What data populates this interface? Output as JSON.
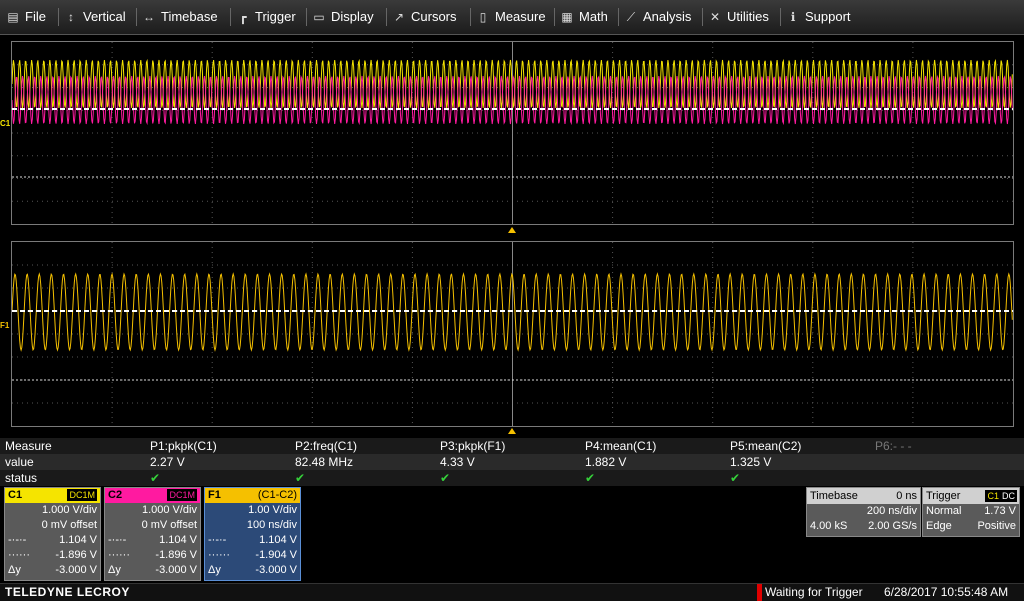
{
  "menu": [
    {
      "label": "File",
      "icon": "file-icon"
    },
    {
      "label": "Vertical",
      "icon": "vertical-icon"
    },
    {
      "label": "Timebase",
      "icon": "timebase-icon"
    },
    {
      "label": "Trigger",
      "icon": "trigger-icon"
    },
    {
      "label": "Display",
      "icon": "display-icon"
    },
    {
      "label": "Cursors",
      "icon": "cursors-icon"
    },
    {
      "label": "Measure",
      "icon": "measure-icon"
    },
    {
      "label": "Math",
      "icon": "math-icon"
    },
    {
      "label": "Analysis",
      "icon": "analysis-icon"
    },
    {
      "label": "Utilities",
      "icon": "utilities-icon"
    },
    {
      "label": "Support",
      "icon": "support-icon"
    }
  ],
  "grids": {
    "upper_marker": "C1",
    "lower_marker": "F1"
  },
  "colors": {
    "c1": "#f5e400",
    "c2": "#ff1aa0",
    "f1": "#f5c000",
    "check": "#35d13a"
  },
  "measure": {
    "row_labels": [
      "Measure",
      "value",
      "status"
    ],
    "params": [
      {
        "name": "P1:pkpk(C1)",
        "value": "2.27 V",
        "ok": true
      },
      {
        "name": "P2:freq(C1)",
        "value": "82.48 MHz",
        "ok": true
      },
      {
        "name": "P3:pkpk(F1)",
        "value": "4.33 V",
        "ok": true
      },
      {
        "name": "P4:mean(C1)",
        "value": "1.882 V",
        "ok": true
      },
      {
        "name": "P5:mean(C2)",
        "value": "1.325 V",
        "ok": true
      },
      {
        "name": "P6:- - -",
        "value": "",
        "ok": false
      }
    ]
  },
  "channels": [
    {
      "name": "C1",
      "coupling": "DC1M",
      "vdiv": "1.000 V/div",
      "offset": "0 mV offset",
      "l1": "1.104 V",
      "l2": "-1.896 V",
      "dy": "-3.000 V",
      "dy_label": "Δy"
    },
    {
      "name": "C2",
      "coupling": "DC1M",
      "vdiv": "1.000 V/div",
      "offset": "0 mV offset",
      "l1": "1.104 V",
      "l2": "-1.896 V",
      "dy": "-3.000 V",
      "dy_label": "Δy"
    },
    {
      "name": "F1",
      "coupling": "(C1-C2)",
      "vdiv": "1.00 V/div",
      "offset": "100 ns/div",
      "l1": "1.104 V",
      "l2": "-1.904 V",
      "dy": "-3.000 V",
      "dy_label": "Δy"
    }
  ],
  "timebase": {
    "label": "Timebase",
    "delay": "0 ns",
    "tdiv": "200 ns/div",
    "samples": "4.00 kS",
    "rate": "2.00 GS/s"
  },
  "trigger": {
    "label": "Trigger",
    "src": "C1",
    "coup": "DC",
    "mode": "Normal",
    "level": "1.73 V",
    "type": "Edge",
    "slope": "Positive"
  },
  "status": {
    "brand": "TELEDYNE LECROY",
    "message": "Waiting for Trigger",
    "datetime": "6/28/2017 10:55:48 AM"
  }
}
